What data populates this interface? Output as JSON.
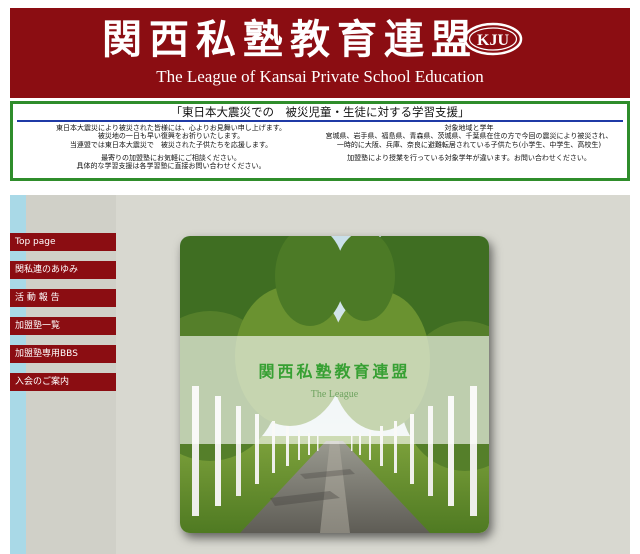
{
  "header": {
    "title_jp": "関西私塾教育連盟",
    "title_en": "The League of Kansai Private School Education",
    "logo_text": "KJU"
  },
  "notice": {
    "title": "「東日本大震災での　被災児童・生徒に対する学習支援」",
    "left_lines": [
      "東日本大震災により被災された皆様には、心よりお見舞い申し上げます。",
      "被災地の一日も早い復興をお祈りいたします。",
      "当連盟では東日本大震災で　被災された子供たちを応援します。",
      "",
      "最寄りの加盟塾にお気軽にご相談ください。",
      "具体的な学習支援は各学習塾に直接お問い合わせください。"
    ],
    "right_lines": [
      "対象地域と学年",
      "宮城県、岩手県、福島県、青森県、茨城県、千葉県在住の方で今回の震災により被災され、",
      "一時的に大阪、兵庫、奈良に避難転居されている子供たち(小学生、中学生、高校生)",
      "",
      "加盟塾により授業を行っている対象学年が違います。お問い合わせください。"
    ]
  },
  "nav": {
    "items": [
      {
        "label": "Top page"
      },
      {
        "label": "関私連のあゆみ"
      },
      {
        "label": "活 動 報 告"
      },
      {
        "label": "加盟塾一覧"
      },
      {
        "label": "加盟塾専用BBS"
      },
      {
        "label": "入会のご案内"
      }
    ]
  },
  "hero": {
    "title": "関西私塾教育連盟",
    "subtitle": "The League"
  },
  "colors": {
    "header_bg": "#8b0d12",
    "notice_border": "#2f8d2b",
    "notice_rule": "#1f3aa6",
    "nav_bg": "#8b0d12",
    "hero_title": "#37a033"
  }
}
